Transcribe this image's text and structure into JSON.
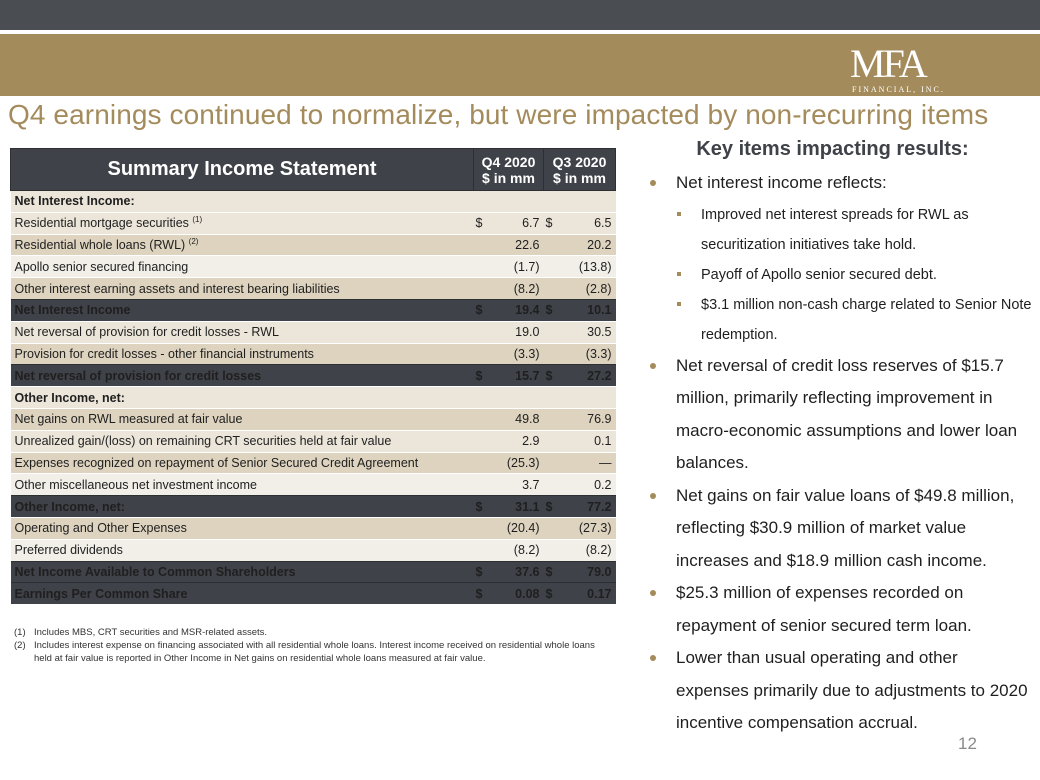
{
  "header": {
    "logo_main": "MFA",
    "logo_sub": "FINANCIAL, INC.",
    "title": "Q4 earnings continued to normalize, but were impacted by non-recurring items",
    "colors": {
      "gold": "#a48b5c",
      "dark": "#3f4248"
    }
  },
  "statement": {
    "title": "Summary Income Statement",
    "col1_line1": "Q4 2020",
    "col1_line2": "$ in mm",
    "col2_line1": "Q3 2020",
    "col2_line2": "$ in mm",
    "rows": [
      {
        "label": "Net Interest Income:",
        "sup": "",
        "cur1": "",
        "v1": "",
        "cur2": "",
        "v2": ""
      },
      {
        "label": "Residential mortgage securities",
        "sup": "(1)",
        "cur1": "$",
        "v1": "6.7",
        "cur2": "$",
        "v2": "6.5"
      },
      {
        "label": "Residential whole loans (RWL)",
        "sup": "(2)",
        "cur1": "",
        "v1": "22.6",
        "cur2": "",
        "v2": "20.2"
      },
      {
        "label": "Apollo senior secured financing",
        "sup": "",
        "cur1": "",
        "v1": "(1.7)",
        "cur2": "",
        "v2": "(13.8)"
      },
      {
        "label": "Other interest earning assets and interest bearing liabilities",
        "sup": "",
        "cur1": "",
        "v1": "(8.2)",
        "cur2": "",
        "v2": "(2.8)"
      },
      {
        "label": "Net Interest Income",
        "sup": "",
        "cur1": "$",
        "v1": "19.4",
        "cur2": "$",
        "v2": "10.1"
      },
      {
        "label": "Net reversal of provision for credit losses - RWL",
        "sup": "",
        "cur1": "",
        "v1": "19.0",
        "cur2": "",
        "v2": "30.5"
      },
      {
        "label": "Provision for credit losses - other financial instruments",
        "sup": "",
        "cur1": "",
        "v1": "(3.3)",
        "cur2": "",
        "v2": "(3.3)"
      },
      {
        "label": "Net reversal of provision for credit  losses",
        "sup": "",
        "cur1": "$",
        "v1": "15.7",
        "cur2": "$",
        "v2": "27.2"
      },
      {
        "label": "Other Income, net:",
        "sup": "",
        "cur1": "",
        "v1": "",
        "cur2": "",
        "v2": ""
      },
      {
        "label": "Net gains on RWL measured at fair value",
        "sup": "",
        "cur1": "",
        "v1": "49.8",
        "cur2": "",
        "v2": "76.9"
      },
      {
        "label": "Unrealized gain/(loss) on remaining CRT securities held at fair value",
        "sup": "",
        "cur1": "",
        "v1": "2.9",
        "cur2": "",
        "v2": "0.1"
      },
      {
        "label": "Expenses recognized on repayment of Senior Secured Credit Agreement",
        "sup": "",
        "cur1": "",
        "v1": "(25.3)",
        "cur2": "",
        "v2": "—"
      },
      {
        "label": "Other miscellaneous net investment income",
        "sup": "",
        "cur1": "",
        "v1": "3.7",
        "cur2": "",
        "v2": "0.2"
      },
      {
        "label": "Other Income, net:",
        "sup": "",
        "cur1": "$",
        "v1": "31.1",
        "cur2": "$",
        "v2": "77.2"
      },
      {
        "label": "Operating and Other Expenses",
        "sup": "",
        "cur1": "",
        "v1": "(20.4)",
        "cur2": "",
        "v2": "(27.3)"
      },
      {
        "label": "Preferred dividends",
        "sup": "",
        "cur1": "",
        "v1": "(8.2)",
        "cur2": "",
        "v2": "(8.2)"
      },
      {
        "label": "Net Income Available to Common Shareholders",
        "sup": "",
        "cur1": "$",
        "v1": "37.6",
        "cur2": "$",
        "v2": "79.0"
      },
      {
        "label": "Earnings Per Common Share",
        "sup": "",
        "cur1": "$",
        "v1": "0.08",
        "cur2": "$",
        "v2": "0.17"
      }
    ]
  },
  "footnotes": [
    {
      "mark": "(1)",
      "text": "Includes MBS, CRT securities and MSR-related assets."
    },
    {
      "mark": "(2)",
      "text": "Includes interest expense on financing associated with all residential whole loans. Interest income received on residential whole loans held at fair value is reported in Other Income in Net gains on residential whole loans measured at fair value."
    }
  ],
  "key_items": {
    "heading": "Key items impacting results:",
    "b1": "Net interest income reflects:",
    "b1_sub1": "Improved net interest spreads for RWL as securitization initiatives take hold.",
    "b1_sub2": "Payoff of Apollo senior secured debt.",
    "b1_sub3": "$3.1 million non-cash charge related to Senior Note redemption.",
    "b2": "Net reversal of credit loss reserves of $15.7 million, primarily reflecting improvement in macro-economic assumptions and lower loan balances.",
    "b3": "Net gains on fair value loans of $49.8 million, reflecting $30.9 million of market value increases and $18.9 million cash income.",
    "b4": "$25.3 million of expenses recorded on repayment of senior secured term loan.",
    "b5": "Lower than usual operating and other expenses primarily due to adjustments to 2020 incentive compensation accrual."
  },
  "page_number": "12"
}
